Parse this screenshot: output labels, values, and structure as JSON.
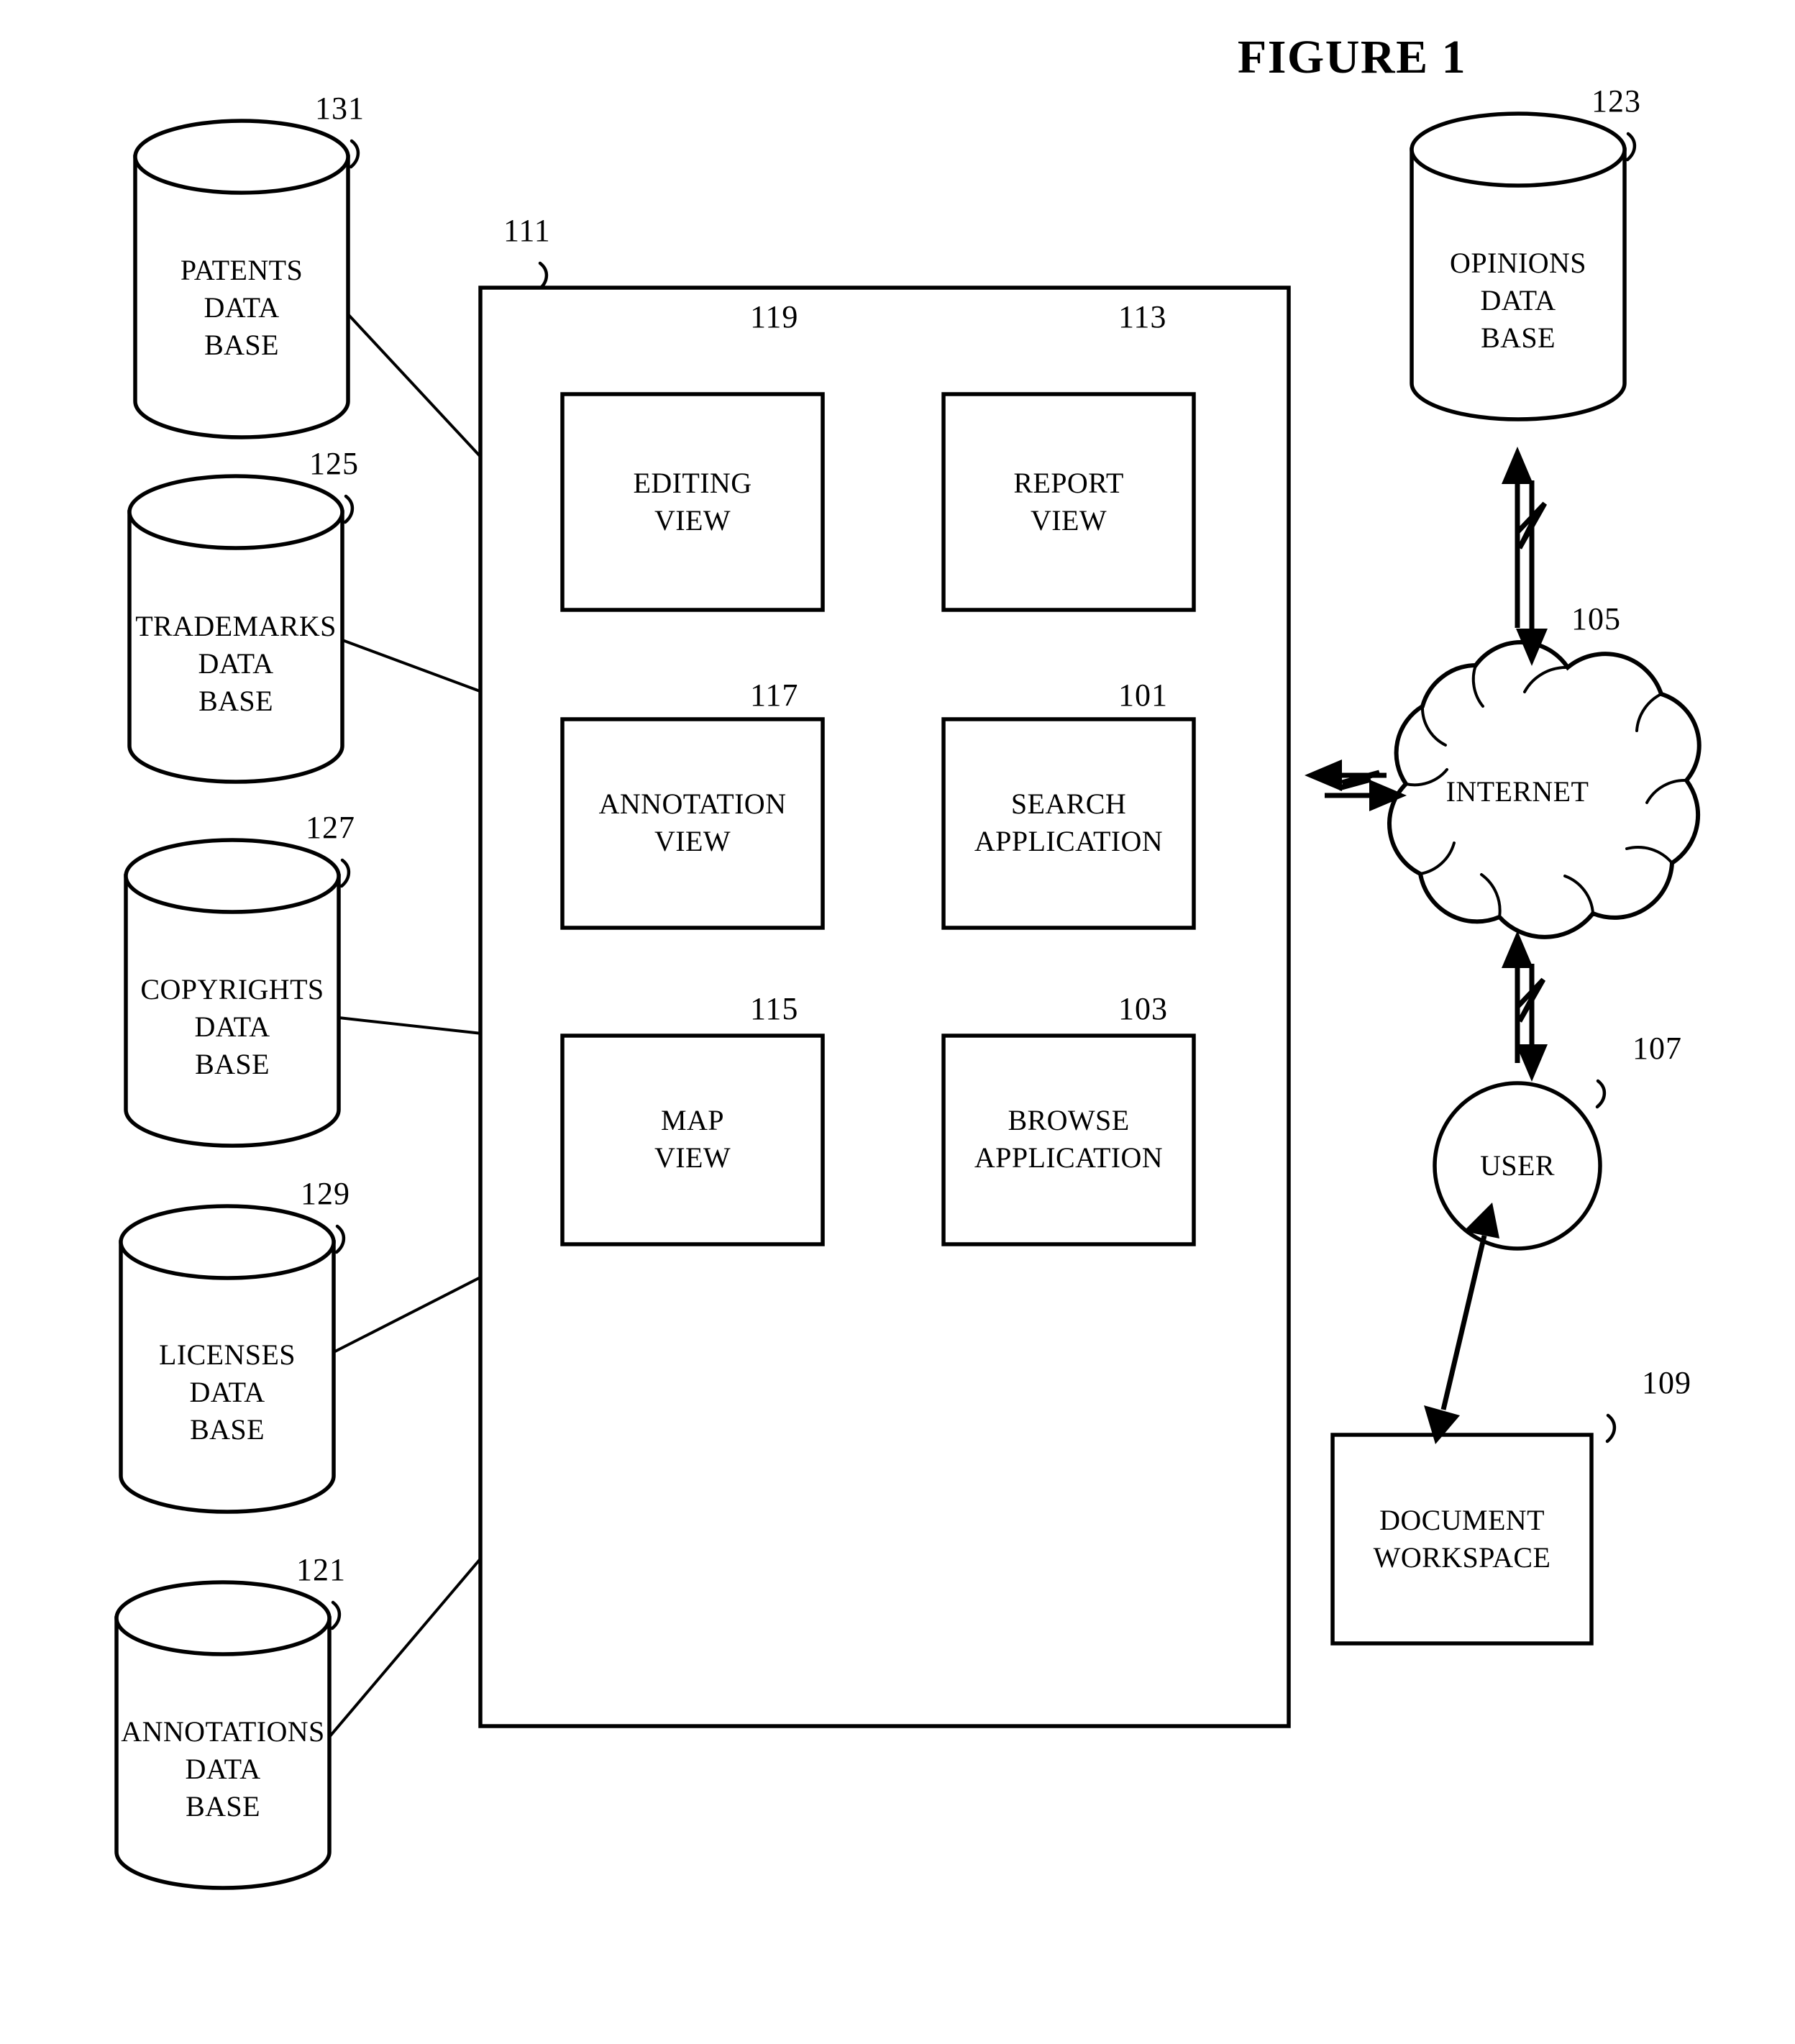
{
  "figure": {
    "title": "FIGURE 1"
  },
  "system": {
    "container": {
      "ref": "111",
      "label": ""
    },
    "modules": [
      {
        "ref": "119",
        "label": "EDITING\nVIEW",
        "name": "editing-view"
      },
      {
        "ref": "113",
        "label": "REPORT\nVIEW",
        "name": "report-view"
      },
      {
        "ref": "117",
        "label": "ANNOTATION\nVIEW",
        "name": "annotation-view"
      },
      {
        "ref": "101",
        "label": "SEARCH\nAPPLICATION",
        "name": "search-application"
      },
      {
        "ref": "115",
        "label": "MAP\nVIEW",
        "name": "map-view"
      },
      {
        "ref": "103",
        "label": "BROWSE\nAPPLICATION",
        "name": "browse-application"
      }
    ]
  },
  "databases_left": [
    {
      "ref": "131",
      "label": "PATENTS\nDATA\nBASE",
      "name": "patents-database"
    },
    {
      "ref": "125",
      "label": "TRADEMARKS\nDATA\nBASE",
      "name": "trademarks-database"
    },
    {
      "ref": "127",
      "label": "COPYRIGHTS\nDATA\nBASE",
      "name": "copyrights-database"
    },
    {
      "ref": "129",
      "label": "LICENSES\nDATA\nBASE",
      "name": "licenses-database"
    },
    {
      "ref": "121",
      "label": "ANNOTATIONS\nDATA\nBASE",
      "name": "annotations-database"
    }
  ],
  "databases_right": [
    {
      "ref": "123",
      "label": "OPINIONS\nDATA\nBASE",
      "name": "opinions-database"
    }
  ],
  "network": {
    "cloud": {
      "ref": "105",
      "label": "INTERNET",
      "name": "internet-cloud"
    },
    "user": {
      "ref": "107",
      "label": "USER",
      "name": "user-node"
    },
    "workspace": {
      "ref": "109",
      "label": "DOCUMENT\nWORKSPACE",
      "name": "document-workspace"
    }
  },
  "colors": {
    "ink": "#000000",
    "paper": "#ffffff"
  }
}
